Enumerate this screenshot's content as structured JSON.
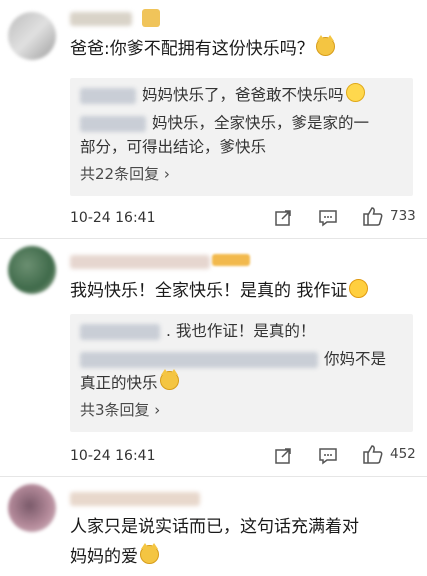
{
  "comments": [
    {
      "text": "爸爸:你爹不配拥有这份快乐吗？",
      "emoji": "cat-emoji",
      "replies": [
        {
          "text": "妈妈快乐了，爸爸敢不快乐吗",
          "emoji": "smile-emoji"
        },
        {
          "text_line1": "妈快乐，全家快乐，爹是家的一",
          "text_line2": "部分，可得出结论，爹快乐"
        }
      ],
      "more_replies": "共22条回复 ›",
      "time": "10-24 16:41",
      "likes": "733"
    },
    {
      "text": "我妈快乐！全家快乐！是真的 我作证",
      "emoji": "laugh-emoji",
      "replies": [
        {
          "text": ". 我也作证！是真的！"
        },
        {
          "text_line1": "你妈不是",
          "text_line2": "真正的快乐",
          "emoji": "cat-emoji"
        }
      ],
      "more_replies": "共3条回复 ›",
      "time": "10-24 16:41",
      "likes": "452"
    },
    {
      "text_line1": "人家只是说实话而已，这句话充满着对",
      "text_line2": "妈妈的爱",
      "emoji": "cat-emoji"
    }
  ],
  "icons": {
    "share": "share-icon",
    "comment": "comment-icon",
    "like": "thumbs-up-icon"
  }
}
